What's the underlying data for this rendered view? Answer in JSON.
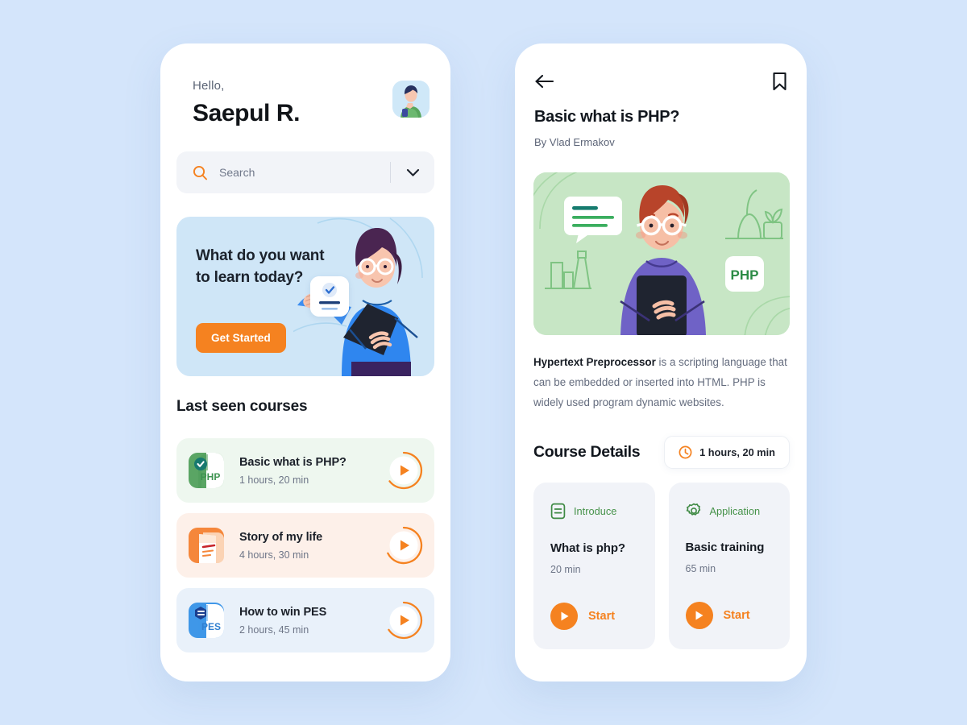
{
  "theme": {
    "background": "#d4e5fb",
    "accent_orange": "#f58220",
    "green": "#46924a",
    "card_white": "#ffffff"
  },
  "left_phone": {
    "greeting": "Hello,",
    "user_name": "Saepul R.",
    "avatar_icon": "user-avatar-photo",
    "search": {
      "placeholder": "Search",
      "value": "",
      "icon": "search-icon",
      "dropdown_icon": "chevron-down-icon"
    },
    "banner": {
      "title": "What do you want to learn today?",
      "button_label": "Get Started",
      "illustration": "woman-with-tablet-illustration",
      "checkcard_icon": "checkbox-card-icon"
    },
    "section_title": "Last seen courses",
    "courses": [
      {
        "name": "Basic what is PHP?",
        "duration": "1 hours, 20 min",
        "icon": "php-course-icon",
        "badge": "check-badge-icon",
        "bg": "#eef7ef",
        "play_icon": "play-icon",
        "progress": 78
      },
      {
        "name": "Story of my life",
        "duration": "4 hours, 30 min",
        "icon": "document-course-icon",
        "badge": "",
        "bg": "#fdf0e9",
        "play_icon": "play-icon",
        "progress": 52
      },
      {
        "name": "How to win PES",
        "duration": "2 hours, 45 min",
        "icon": "pes-course-icon",
        "badge": "menu-badge-icon",
        "bg": "#e9f1fa",
        "play_icon": "play-icon",
        "progress": 65
      }
    ]
  },
  "right_phone": {
    "back_icon": "arrow-left-icon",
    "bookmark_icon": "bookmark-icon",
    "title": "Basic what is PHP?",
    "author": "By Vlad Ermakov",
    "hero": {
      "illustration": "man-with-tablet-illustration",
      "badge_label": "PHP",
      "card_icon": "text-lines-card-icon",
      "plant_icon": "plant-shelf-icon"
    },
    "description_bold": "Hypertext Preprocessor",
    "description_rest": " is a scripting language that can be embedded or inserted into HTML. PHP is widely used program dynamic websites.",
    "details_title": "Course Details",
    "duration_badge": {
      "icon": "clock-icon",
      "label": "1 hours, 20 min"
    },
    "detail_cards": [
      {
        "kind": "Introduce",
        "kind_icon": "document-outline-icon",
        "name": "What is php?",
        "duration": "20 min",
        "action_label": "Start",
        "action_icon": "play-icon"
      },
      {
        "kind": "Application",
        "kind_icon": "gear-icon",
        "name": "Basic training",
        "duration": "65 min",
        "action_label": "Start",
        "action_icon": "play-icon"
      }
    ]
  }
}
